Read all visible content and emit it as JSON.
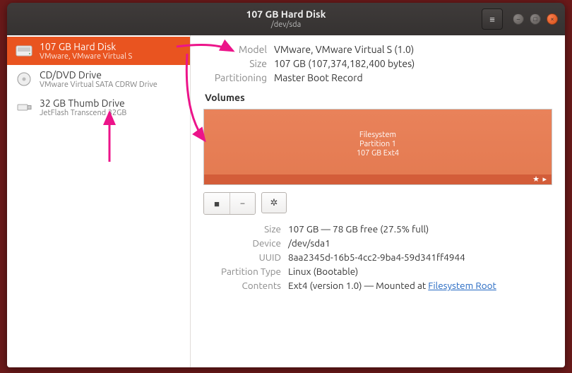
{
  "titlebar": {
    "title": "107 GB Hard Disk",
    "subtitle": "/dev/sda"
  },
  "colors": {
    "accent": "#e95420",
    "arrow": "#ec148a"
  },
  "sidebar": {
    "items": [
      {
        "title": "107 GB Hard Disk",
        "subtitle": "VMware, VMware Virtual S",
        "icon": "disk-icon",
        "selected": true
      },
      {
        "title": "CD/DVD Drive",
        "subtitle": "VMware Virtual SATA CDRW Drive",
        "icon": "optical-icon",
        "selected": false
      },
      {
        "title": "32 GB Thumb Drive",
        "subtitle": "JetFlash Transcend 32GB",
        "icon": "usb-icon",
        "selected": false
      }
    ]
  },
  "details": {
    "model_label": "Model",
    "model_value": "VMware, VMware Virtual S (1.0)",
    "size_label": "Size",
    "size_value": "107 GB (107,374,182,400 bytes)",
    "part_label": "Partitioning",
    "part_value": "Master Boot Record"
  },
  "volumes": {
    "header": "Volumes",
    "partition": {
      "line1": "Filesystem",
      "line2": "Partition 1",
      "line3": "107 GB Ext4",
      "star": "★ ▸"
    }
  },
  "toolbar": {
    "stop": "■",
    "minus": "−",
    "gear": "✲"
  },
  "partition_details": {
    "size_label": "Size",
    "size_value": "107 GB — 78 GB free (27.5% full)",
    "device_label": "Device",
    "device_value": "/dev/sda1",
    "uuid_label": "UUID",
    "uuid_value": "8aa2345d-16b5-4cc2-9ba4-59d341ff4944",
    "pt_label": "Partition Type",
    "pt_value": "Linux (Bootable)",
    "contents_label": "Contents",
    "contents_prefix": "Ext4 (version 1.0) — Mounted at ",
    "contents_link": "Filesystem Root"
  }
}
